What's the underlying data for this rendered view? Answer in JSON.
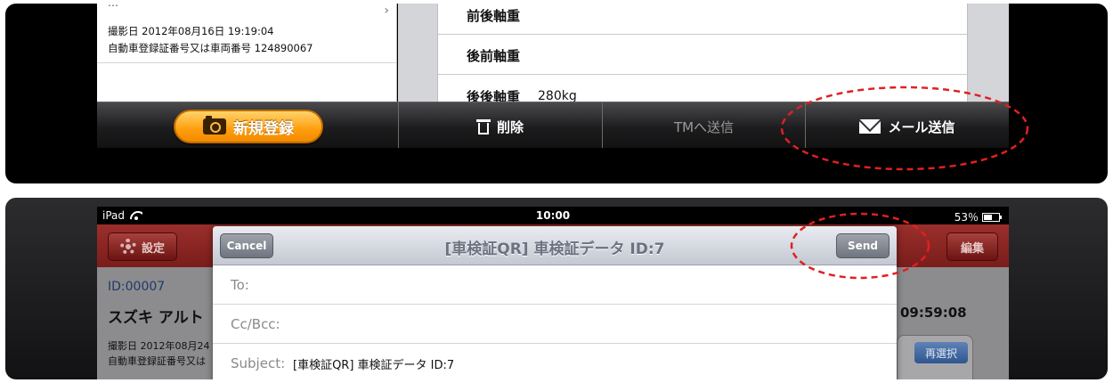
{
  "top": {
    "list": {
      "clipped_text": "…",
      "date_line": "撮影日 2012年08月16日 19:19:04",
      "reg_line": "自動車登録証番号又は車両番号 124890067"
    },
    "detail_rows": [
      {
        "label": "前後軸重",
        "value": ""
      },
      {
        "label": "後前軸重",
        "value": ""
      },
      {
        "label": "後後軸重",
        "value": "280kg"
      }
    ],
    "toolbar": {
      "new_label": "新規登録",
      "delete_label": "削除",
      "tm_label": "TMへ送信",
      "mail_label": "メール送信"
    }
  },
  "bottom": {
    "status": {
      "device": "iPad",
      "time": "10:00",
      "battery": "53％"
    },
    "nav": {
      "settings_label": "設定",
      "edit_label": "編集"
    },
    "background": {
      "id": "ID:00007",
      "name": "スズキ アルト",
      "date": "撮影日 2012年08月24",
      "reg": "自動車登録証番号又は",
      "time": "09:59:08",
      "reselect_label": "再選択"
    },
    "mail": {
      "title": "[車検証QR] 車検証データ ID:7",
      "cancel_label": "Cancel",
      "send_label": "Send",
      "to_label": "To:",
      "ccbcc_label": "Cc/Bcc:",
      "subject_label": "Subject:",
      "subject_value": "[車検証QR] 車検証データ ID:7"
    }
  },
  "colors": {
    "annotation": "#e02020",
    "accent_orange": "#ff9d0d",
    "nav_red": "#8a2624"
  }
}
